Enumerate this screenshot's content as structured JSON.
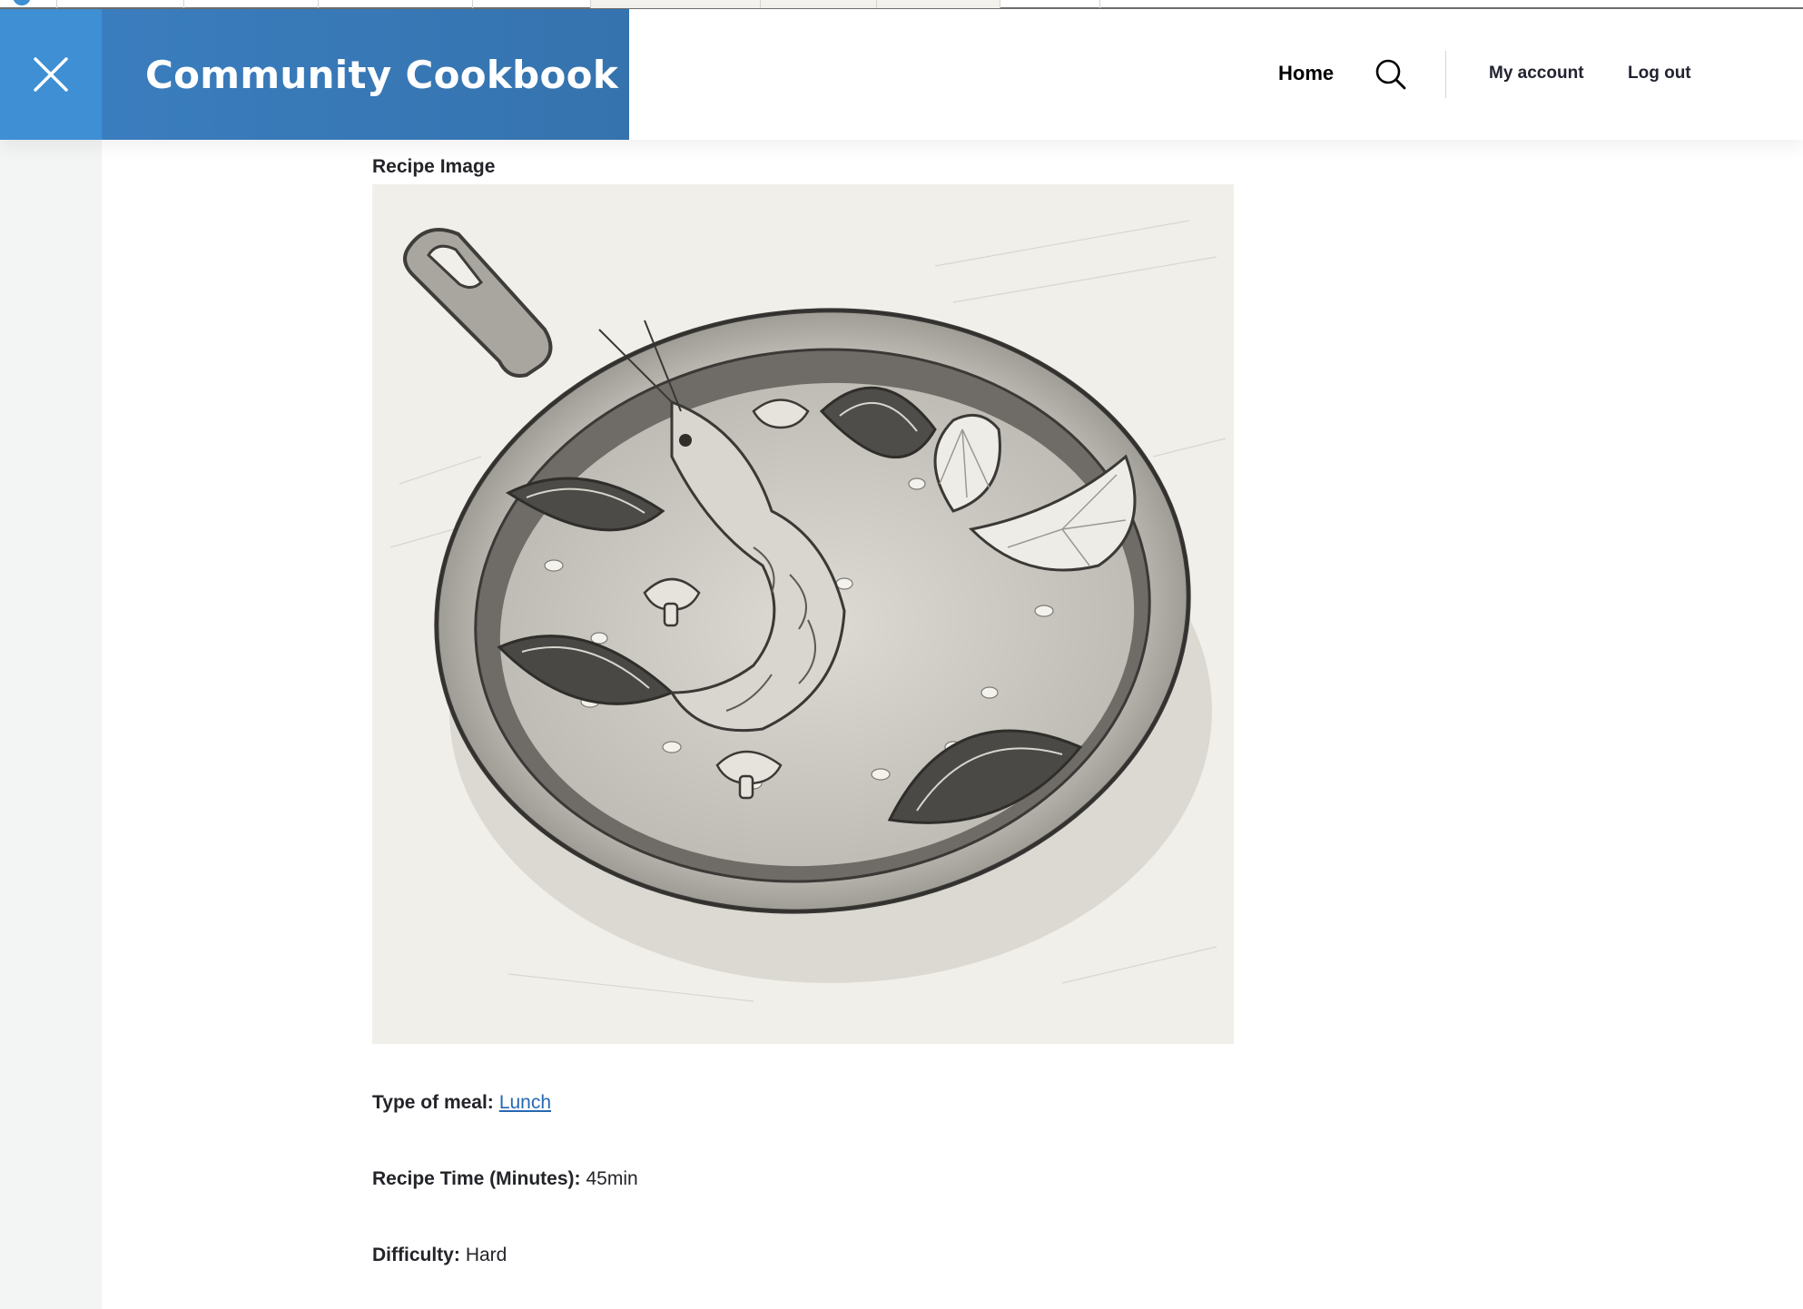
{
  "site": {
    "title": "Community Cookbook"
  },
  "nav": {
    "home": "Home",
    "my_account": "My account",
    "log_out": "Log out"
  },
  "icons": {
    "close": "close-icon",
    "search": "search-icon"
  },
  "colors": {
    "close_bg": "#3e8fd3",
    "brand_bg": "#3573ae",
    "link": "#2768b2"
  },
  "recipe": {
    "image_label": "Recipe Image",
    "meal_type_label": "Type of meal:",
    "meal_type_value": "Lunch",
    "time_label": "Recipe Time (Minutes):",
    "time_value": "45min",
    "difficulty_label": "Difficulty:",
    "difficulty_value": "Hard"
  }
}
